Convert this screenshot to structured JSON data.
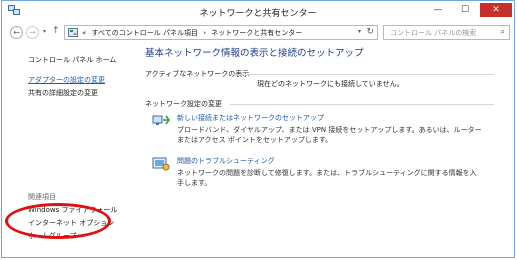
{
  "window": {
    "title": "ネットワークと共有センター"
  },
  "controls": {
    "minimize": "—",
    "maximize": "☐",
    "close": "✕"
  },
  "nav": {
    "back": "←",
    "forward": "→",
    "dropdown": "▾",
    "up": "↑"
  },
  "address": {
    "sep": "«",
    "crumbs": [
      "すべてのコントロール パネル項目",
      "›",
      "ネットワークと共有センター"
    ],
    "dropdown": "▾",
    "refresh": "↻"
  },
  "search": {
    "placeholder": "コントロール パネルの検索",
    "icon": "⌕"
  },
  "sidebar": {
    "home": "コントロール パネル ホーム",
    "adapter": "アダプターの設定の変更",
    "sharing": "共有の詳細設定の変更",
    "related_header": "関連項目",
    "firewall": "Windows ファイアウォール",
    "internet_options": "インターネット オプション",
    "homegroup": "ホームグループ"
  },
  "main": {
    "title": "基本ネットワーク情報の表示と接続のセットアップ",
    "active_header": "アクティブなネットワークの表示",
    "active_status": "現在どのネットワークにも接続していません。",
    "change_header": "ネットワーク設定の変更",
    "task1_link": "新しい接続またはネットワークのセットアップ",
    "task1_desc": "ブロードバンド、ダイヤルアップ、または VPN 接続をセットアップします。あるいは、ルーターまたはアクセス ポイントをセットアップします。",
    "task2_link": "問題のトラブルシューティング",
    "task2_desc": "ネットワークの問題を診断して修復します。または、トラブルシューティングに関する情報を入手します。"
  },
  "colors": {
    "accent": "#1e5aa8",
    "heading": "#1e3f8a",
    "highlight": "#e01010",
    "close": "#c7312a"
  }
}
